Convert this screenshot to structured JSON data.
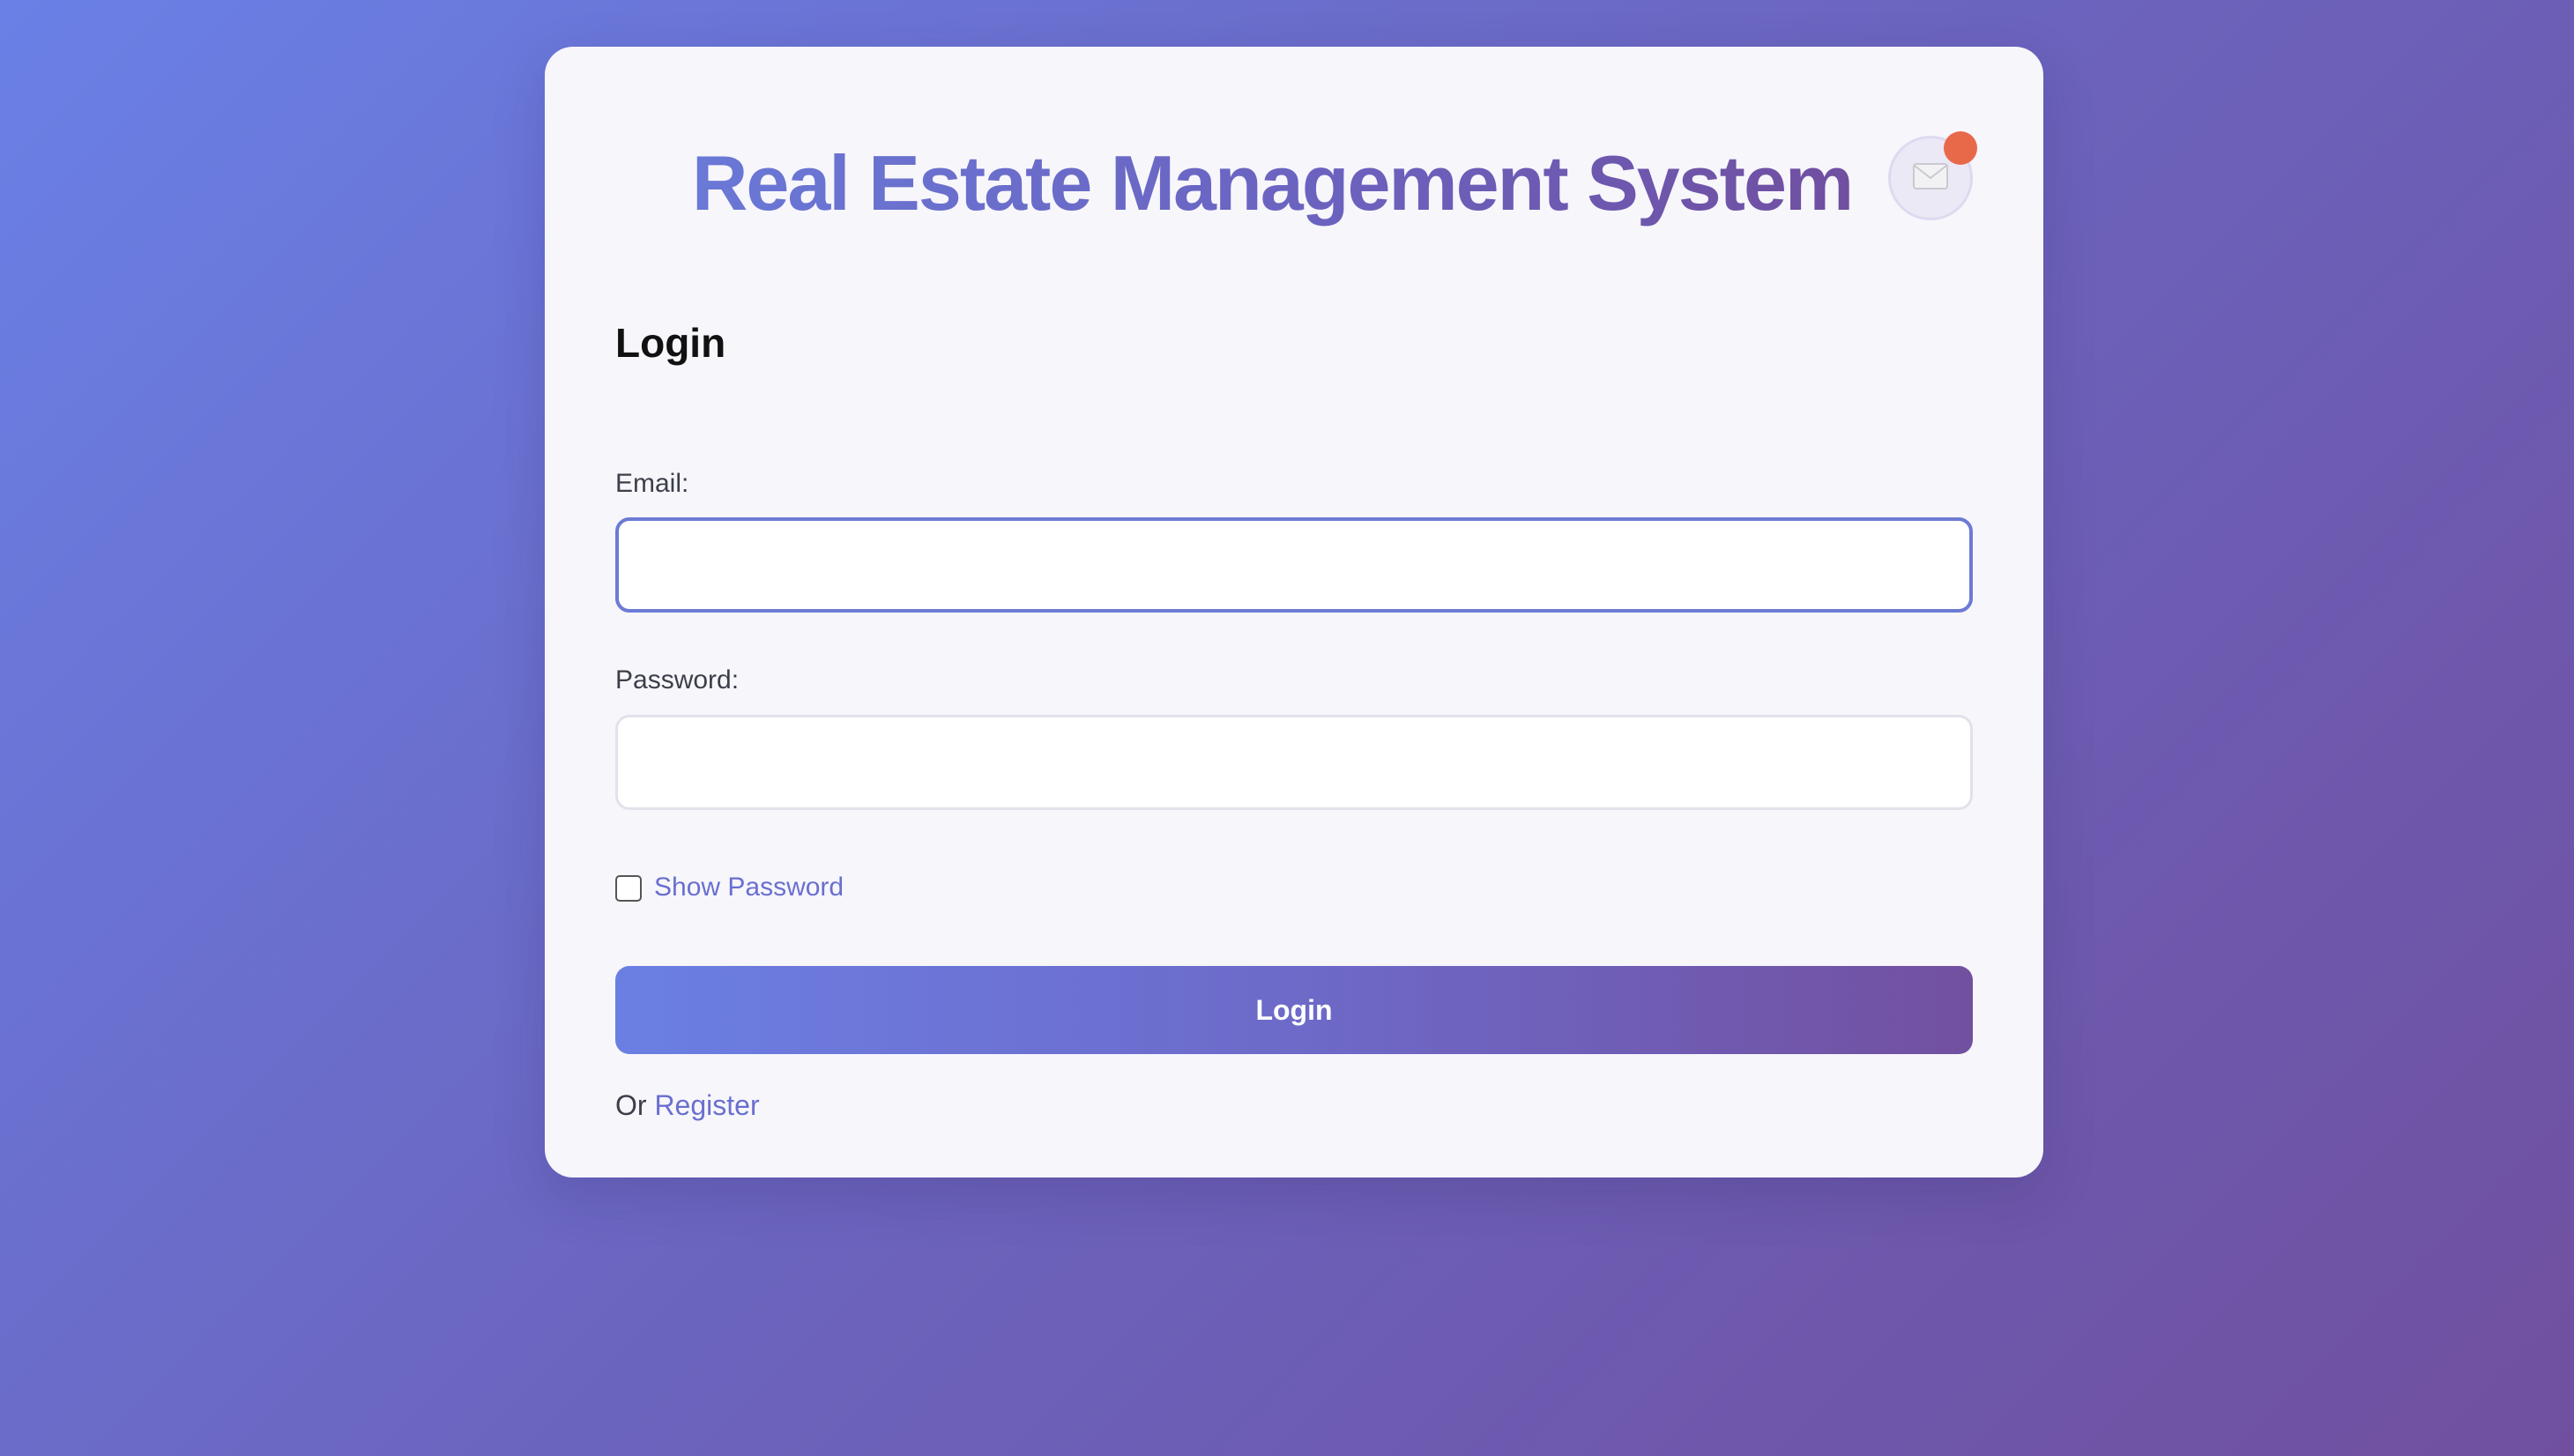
{
  "header": {
    "title": "Real Estate Management System",
    "notification_icon": "envelope-icon",
    "badge_color": "#e8694a"
  },
  "form": {
    "heading": "Login",
    "email_label": "Email:",
    "email_value": "",
    "password_label": "Password:",
    "password_value": "",
    "show_password_label": "Show Password",
    "show_password_checked": false,
    "submit_label": "Login"
  },
  "footer": {
    "or_text": "Or",
    "register_label": "Register"
  },
  "colors": {
    "accent": "#6a6fcf",
    "gradient_start": "#6b7fe3",
    "gradient_end": "#7250a0"
  }
}
